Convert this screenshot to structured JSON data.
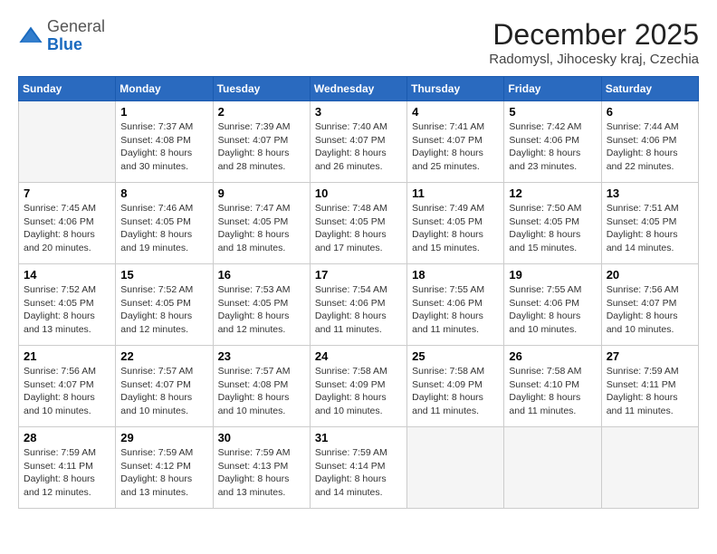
{
  "header": {
    "logo": {
      "general": "General",
      "blue": "Blue"
    },
    "title": "December 2025",
    "location": "Radomysl, Jihocesky kraj, Czechia"
  },
  "weekdays": [
    "Sunday",
    "Monday",
    "Tuesday",
    "Wednesday",
    "Thursday",
    "Friday",
    "Saturday"
  ],
  "weeks": [
    [
      {
        "day": "",
        "info": ""
      },
      {
        "day": "1",
        "info": "Sunrise: 7:37 AM\nSunset: 4:08 PM\nDaylight: 8 hours\nand 30 minutes."
      },
      {
        "day": "2",
        "info": "Sunrise: 7:39 AM\nSunset: 4:07 PM\nDaylight: 8 hours\nand 28 minutes."
      },
      {
        "day": "3",
        "info": "Sunrise: 7:40 AM\nSunset: 4:07 PM\nDaylight: 8 hours\nand 26 minutes."
      },
      {
        "day": "4",
        "info": "Sunrise: 7:41 AM\nSunset: 4:07 PM\nDaylight: 8 hours\nand 25 minutes."
      },
      {
        "day": "5",
        "info": "Sunrise: 7:42 AM\nSunset: 4:06 PM\nDaylight: 8 hours\nand 23 minutes."
      },
      {
        "day": "6",
        "info": "Sunrise: 7:44 AM\nSunset: 4:06 PM\nDaylight: 8 hours\nand 22 minutes."
      }
    ],
    [
      {
        "day": "7",
        "info": "Sunrise: 7:45 AM\nSunset: 4:06 PM\nDaylight: 8 hours\nand 20 minutes."
      },
      {
        "day": "8",
        "info": "Sunrise: 7:46 AM\nSunset: 4:05 PM\nDaylight: 8 hours\nand 19 minutes."
      },
      {
        "day": "9",
        "info": "Sunrise: 7:47 AM\nSunset: 4:05 PM\nDaylight: 8 hours\nand 18 minutes."
      },
      {
        "day": "10",
        "info": "Sunrise: 7:48 AM\nSunset: 4:05 PM\nDaylight: 8 hours\nand 17 minutes."
      },
      {
        "day": "11",
        "info": "Sunrise: 7:49 AM\nSunset: 4:05 PM\nDaylight: 8 hours\nand 15 minutes."
      },
      {
        "day": "12",
        "info": "Sunrise: 7:50 AM\nSunset: 4:05 PM\nDaylight: 8 hours\nand 15 minutes."
      },
      {
        "day": "13",
        "info": "Sunrise: 7:51 AM\nSunset: 4:05 PM\nDaylight: 8 hours\nand 14 minutes."
      }
    ],
    [
      {
        "day": "14",
        "info": "Sunrise: 7:52 AM\nSunset: 4:05 PM\nDaylight: 8 hours\nand 13 minutes."
      },
      {
        "day": "15",
        "info": "Sunrise: 7:52 AM\nSunset: 4:05 PM\nDaylight: 8 hours\nand 12 minutes."
      },
      {
        "day": "16",
        "info": "Sunrise: 7:53 AM\nSunset: 4:05 PM\nDaylight: 8 hours\nand 12 minutes."
      },
      {
        "day": "17",
        "info": "Sunrise: 7:54 AM\nSunset: 4:06 PM\nDaylight: 8 hours\nand 11 minutes."
      },
      {
        "day": "18",
        "info": "Sunrise: 7:55 AM\nSunset: 4:06 PM\nDaylight: 8 hours\nand 11 minutes."
      },
      {
        "day": "19",
        "info": "Sunrise: 7:55 AM\nSunset: 4:06 PM\nDaylight: 8 hours\nand 10 minutes."
      },
      {
        "day": "20",
        "info": "Sunrise: 7:56 AM\nSunset: 4:07 PM\nDaylight: 8 hours\nand 10 minutes."
      }
    ],
    [
      {
        "day": "21",
        "info": "Sunrise: 7:56 AM\nSunset: 4:07 PM\nDaylight: 8 hours\nand 10 minutes."
      },
      {
        "day": "22",
        "info": "Sunrise: 7:57 AM\nSunset: 4:07 PM\nDaylight: 8 hours\nand 10 minutes."
      },
      {
        "day": "23",
        "info": "Sunrise: 7:57 AM\nSunset: 4:08 PM\nDaylight: 8 hours\nand 10 minutes."
      },
      {
        "day": "24",
        "info": "Sunrise: 7:58 AM\nSunset: 4:09 PM\nDaylight: 8 hours\nand 10 minutes."
      },
      {
        "day": "25",
        "info": "Sunrise: 7:58 AM\nSunset: 4:09 PM\nDaylight: 8 hours\nand 11 minutes."
      },
      {
        "day": "26",
        "info": "Sunrise: 7:58 AM\nSunset: 4:10 PM\nDaylight: 8 hours\nand 11 minutes."
      },
      {
        "day": "27",
        "info": "Sunrise: 7:59 AM\nSunset: 4:11 PM\nDaylight: 8 hours\nand 11 minutes."
      }
    ],
    [
      {
        "day": "28",
        "info": "Sunrise: 7:59 AM\nSunset: 4:11 PM\nDaylight: 8 hours\nand 12 minutes."
      },
      {
        "day": "29",
        "info": "Sunrise: 7:59 AM\nSunset: 4:12 PM\nDaylight: 8 hours\nand 13 minutes."
      },
      {
        "day": "30",
        "info": "Sunrise: 7:59 AM\nSunset: 4:13 PM\nDaylight: 8 hours\nand 13 minutes."
      },
      {
        "day": "31",
        "info": "Sunrise: 7:59 AM\nSunset: 4:14 PM\nDaylight: 8 hours\nand 14 minutes."
      },
      {
        "day": "",
        "info": ""
      },
      {
        "day": "",
        "info": ""
      },
      {
        "day": "",
        "info": ""
      }
    ]
  ]
}
